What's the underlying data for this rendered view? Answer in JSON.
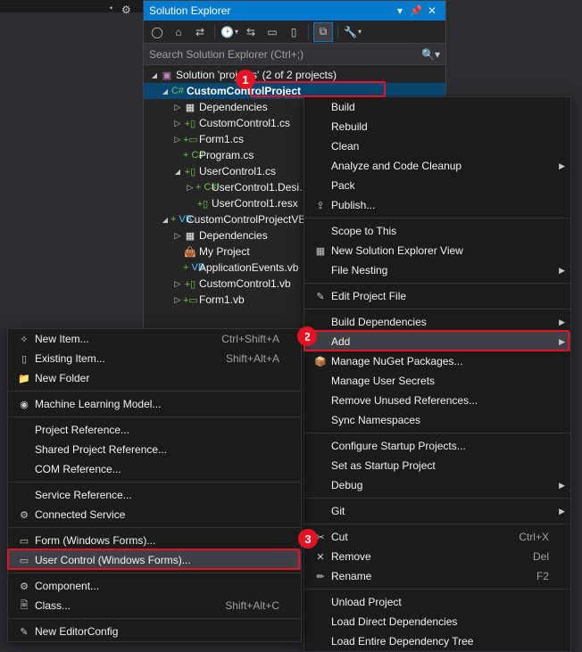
{
  "panel": {
    "title": "Solution Explorer",
    "search_placeholder": "Search Solution Explorer (Ctrl+;)"
  },
  "tree": {
    "root": "Solution 'projects' (2 of 2 projects)",
    "proj1": "CustomControlProject",
    "p1_dep": "Dependencies",
    "p1_f1": "CustomControl1.cs",
    "p1_f2": "Form1.cs",
    "p1_f3": "Program.cs",
    "p1_f4": "UserControl1.cs",
    "p1_f4a": "UserControl1.Desi…",
    "p1_f4b": "UserControl1.resx",
    "proj2": "CustomControlProjectVB",
    "p2_dep": "Dependencies",
    "p2_myp": "My Project",
    "p2_f1": "ApplicationEvents.vb",
    "p2_f2": "CustomControl1.vb",
    "p2_f3": "Form1.vb"
  },
  "menu_main": [
    {
      "label": "Build"
    },
    {
      "label": "Rebuild"
    },
    {
      "label": "Clean"
    },
    {
      "label": "Analyze and Code Cleanup",
      "sub": true
    },
    {
      "label": "Pack"
    },
    {
      "label": "Publish...",
      "icon": "⇪"
    },
    {
      "sep": true
    },
    {
      "label": "Scope to This"
    },
    {
      "label": "New Solution Explorer View",
      "icon": "▦"
    },
    {
      "label": "File Nesting",
      "sub": true
    },
    {
      "sep": true
    },
    {
      "label": "Edit Project File",
      "icon": "✎"
    },
    {
      "sep": true
    },
    {
      "label": "Build Dependencies",
      "sub": true
    },
    {
      "label": "Add",
      "sub": true,
      "hl": true
    },
    {
      "label": "Manage NuGet Packages...",
      "icon": "📦"
    },
    {
      "label": "Manage User Secrets"
    },
    {
      "label": "Remove Unused References..."
    },
    {
      "label": "Sync Namespaces"
    },
    {
      "sep": true
    },
    {
      "label": "Configure Startup Projects..."
    },
    {
      "label": "Set as Startup Project"
    },
    {
      "label": "Debug",
      "sub": true
    },
    {
      "sep": true
    },
    {
      "label": "Git",
      "sub": true
    },
    {
      "sep": true
    },
    {
      "label": "Cut",
      "icon": "✂",
      "shortcut": "Ctrl+X"
    },
    {
      "label": "Remove",
      "icon": "✕",
      "shortcut": "Del"
    },
    {
      "label": "Rename",
      "icon": "✏",
      "shortcut": "F2"
    },
    {
      "sep": true
    },
    {
      "label": "Unload Project"
    },
    {
      "label": "Load Direct Dependencies"
    },
    {
      "label": "Load Entire Dependency Tree"
    }
  ],
  "menu_add": [
    {
      "label": "New Item...",
      "icon": "✧",
      "shortcut": "Ctrl+Shift+A"
    },
    {
      "label": "Existing Item...",
      "icon": "▯",
      "shortcut": "Shift+Alt+A"
    },
    {
      "label": "New Folder",
      "icon": "📁"
    },
    {
      "sep": true
    },
    {
      "label": "Machine Learning Model...",
      "icon": "◉"
    },
    {
      "sep": true
    },
    {
      "label": "Project Reference..."
    },
    {
      "label": "Shared Project Reference..."
    },
    {
      "label": "COM Reference..."
    },
    {
      "sep": true
    },
    {
      "label": "Service Reference..."
    },
    {
      "label": "Connected Service",
      "icon": "⚙"
    },
    {
      "sep": true
    },
    {
      "label": "Form (Windows Forms)...",
      "icon": "▭"
    },
    {
      "label": "User Control (Windows Forms)...",
      "icon": "▭",
      "hl": true
    },
    {
      "sep": true
    },
    {
      "label": "Component...",
      "icon": "⚙"
    },
    {
      "label": "Class...",
      "icon": "🗎",
      "shortcut": "Shift+Alt+C"
    },
    {
      "sep": true
    },
    {
      "label": "New EditorConfig",
      "icon": "✎"
    }
  ],
  "callouts": {
    "1": "1",
    "2": "2",
    "3": "3"
  }
}
